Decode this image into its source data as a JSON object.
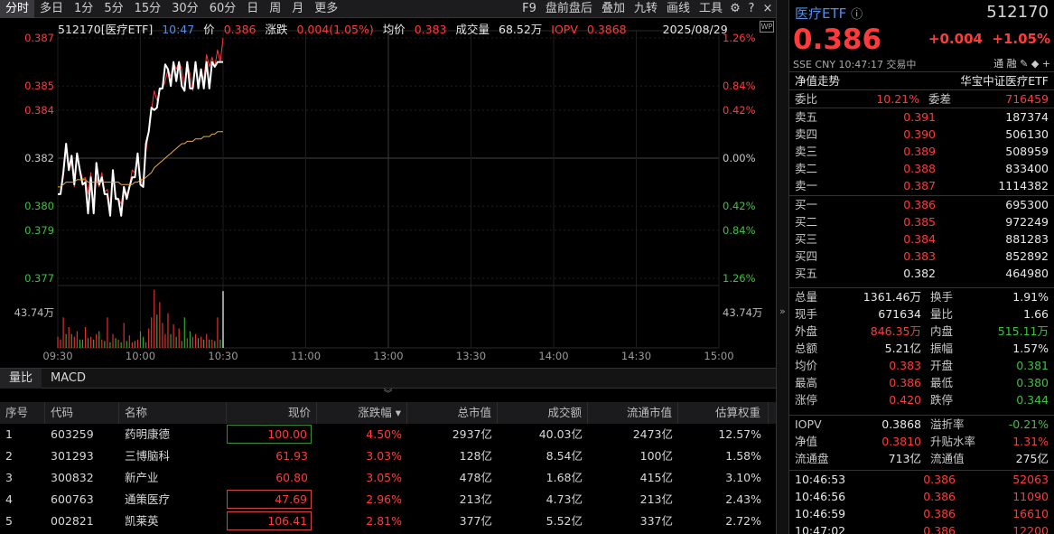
{
  "toolbar": {
    "tabs": [
      "分时",
      "多日",
      "1分",
      "5分",
      "15分",
      "30分",
      "60分",
      "日",
      "周",
      "月",
      "更多"
    ],
    "right_tabs": [
      "F9",
      "盘前盘后",
      "叠加",
      "九转",
      "画线",
      "工具"
    ]
  },
  "info": {
    "code_name": "512170[医疗ETF]",
    "time": "10:47",
    "price_label": "价",
    "price": "0.386",
    "chg_label": "涨跌",
    "chg": "0.004(1.05%)",
    "avg_label": "均价",
    "avg": "0.383",
    "vol_label": "成交量",
    "vol": "68.52万",
    "iopv_label": "IOPV",
    "iopv": "0.3868",
    "date": "2025/08/29",
    "logo": "WP"
  },
  "chart_data": {
    "type": "line",
    "title": "",
    "y_left_ticks": [
      "0.387",
      "0.385",
      "0.384",
      "0.382",
      "0.380",
      "0.379",
      "0.377"
    ],
    "y_right_ticks": [
      "1.26%",
      "0.84%",
      "0.42%",
      "0.00%",
      "0.42%",
      "0.84%",
      "1.26%"
    ],
    "prev_close": 0.382,
    "ylim": [
      0.377,
      0.387
    ],
    "x_ticks": [
      "09:30",
      "10:00",
      "10:30",
      "11:00",
      "13:00",
      "13:30",
      "14:00",
      "14:30",
      "15:00"
    ],
    "vol_label": "43.74万",
    "vol_max": 43.74,
    "series": [
      {
        "values": [
          0.3805,
          0.3805,
          0.3812,
          0.3825,
          0.3815,
          0.3818,
          0.3808,
          0.3822,
          0.3816,
          0.3811,
          0.3812,
          0.3805,
          0.3814,
          0.3798,
          0.3812,
          0.3808,
          0.3814,
          0.3806,
          0.3807,
          0.3799,
          0.3815,
          0.3804,
          0.3803,
          0.3801,
          0.3808,
          0.3805,
          0.3808,
          0.3815,
          0.3814,
          0.3822,
          0.3812,
          0.3808,
          0.3823,
          0.3831,
          0.384,
          0.3848,
          0.3844,
          0.3848,
          0.3849,
          0.3852,
          0.3857,
          0.3854,
          0.386,
          0.3857,
          0.386,
          0.3857,
          0.3849,
          0.386,
          0.3855,
          0.3848,
          0.3858,
          0.3852,
          0.3855,
          0.3853,
          0.3863,
          0.3858,
          0.3862,
          0.3858,
          0.3865,
          0.386,
          0.387
        ]
      },
      {
        "values": [
          0.3805,
          0.3805,
          0.3814,
          0.3826,
          0.3815,
          0.3821,
          0.3809,
          0.3822,
          0.3815,
          0.3809,
          0.381,
          0.3797,
          0.3812,
          0.3797,
          0.3818,
          0.3809,
          0.3812,
          0.3805,
          0.3805,
          0.3796,
          0.3815,
          0.3803,
          0.3803,
          0.3796,
          0.3808,
          0.3803,
          0.3808,
          0.3812,
          0.3812,
          0.3822,
          0.3809,
          0.3808,
          0.3826,
          0.3831,
          0.3841,
          0.384,
          0.3841,
          0.3849,
          0.3849,
          0.3859,
          0.3857,
          0.385,
          0.386,
          0.3852,
          0.386,
          0.385,
          0.3848,
          0.386,
          0.3849,
          0.3849,
          0.386,
          0.3849,
          0.3857,
          0.3849,
          0.386,
          0.3849,
          0.386,
          0.3858,
          0.386,
          0.386,
          0.386
        ]
      },
      {
        "values": [
          0.3808,
          0.3808,
          0.3809,
          0.381,
          0.381,
          0.381,
          0.381,
          0.3811,
          0.3811,
          0.3811,
          0.3811,
          0.381,
          0.381,
          0.381,
          0.381,
          0.381,
          0.381,
          0.381,
          0.381,
          0.381,
          0.381,
          0.381,
          0.381,
          0.3809,
          0.3809,
          0.3809,
          0.3809,
          0.3809,
          0.381,
          0.381,
          0.3811,
          0.3811,
          0.3812,
          0.3813,
          0.3814,
          0.3816,
          0.3817,
          0.3818,
          0.3819,
          0.382,
          0.3821,
          0.3822,
          0.3823,
          0.3824,
          0.3825,
          0.3826,
          0.3826,
          0.3827,
          0.3827,
          0.3827,
          0.3828,
          0.3828,
          0.3828,
          0.3829,
          0.3829,
          0.3829,
          0.383,
          0.383,
          0.3831,
          0.3831,
          0.3831
        ]
      }
    ],
    "volumes": [
      8,
      6,
      22,
      10,
      15,
      10,
      8,
      12,
      6,
      6,
      15,
      7,
      8,
      6,
      10,
      12,
      6,
      5,
      22,
      4,
      10,
      7,
      6,
      4,
      18,
      5,
      9,
      4,
      5,
      6,
      12,
      8,
      4,
      14,
      22,
      42,
      24,
      33,
      18,
      10,
      25,
      10,
      17,
      8,
      14,
      5,
      22,
      7,
      12,
      8,
      10,
      7,
      8,
      6,
      10,
      6,
      6,
      5,
      22,
      6,
      41
    ],
    "vol_up": [
      1,
      1,
      1,
      0,
      1,
      0,
      1,
      1,
      0,
      0,
      1,
      0,
      1,
      0,
      1,
      0,
      1,
      0,
      1,
      0,
      1,
      0,
      1,
      0,
      1,
      0,
      1,
      1,
      0,
      1,
      0,
      0,
      1,
      1,
      1,
      1,
      0,
      1,
      1,
      1,
      1,
      0,
      1,
      0,
      1,
      0,
      0,
      1,
      0,
      1,
      1,
      0,
      1,
      0,
      1,
      0,
      1,
      0,
      1,
      0,
      2
    ]
  },
  "subtabs": [
    "量比",
    "MACD"
  ],
  "table": {
    "headers": [
      "序号",
      "代码",
      "名称",
      "现价",
      "涨跌幅",
      "总市值",
      "成交额",
      "流通市值",
      "估算权重"
    ],
    "rows": [
      [
        "1",
        "603259",
        "药明康德",
        "100.00",
        "4.50%",
        "2937亿",
        "40.03亿",
        "2473亿",
        "12.57%"
      ],
      [
        "2",
        "301293",
        "三博脑科",
        "61.93",
        "3.03%",
        "128亿",
        "8.54亿",
        "100亿",
        "1.58%"
      ],
      [
        "3",
        "300832",
        "新产业",
        "60.80",
        "3.05%",
        "478亿",
        "1.68亿",
        "415亿",
        "3.10%"
      ],
      [
        "4",
        "600763",
        "通策医疗",
        "47.69",
        "2.96%",
        "213亿",
        "4.73亿",
        "213亿",
        "2.43%"
      ],
      [
        "5",
        "002821",
        "凯莱英",
        "106.41",
        "2.81%",
        "377亿",
        "5.52亿",
        "337亿",
        "2.72%"
      ]
    ]
  },
  "panel": {
    "title": "医疗ETF",
    "code": "512170",
    "price": "0.386",
    "chg": "+0.004",
    "pct": "+1.05%",
    "meta": "SSE  CNY  10:47:17  交易中",
    "icons": "通 融 ✎ ◆ +",
    "nav_label": "净值走势",
    "index_name": "华宝中证医疗ETF",
    "webi_label": "委比",
    "webi": "10.21%",
    "weicha_label": "委差",
    "weicha": "716459",
    "asks": [
      [
        "卖五",
        "0.391",
        "187374"
      ],
      [
        "卖四",
        "0.390",
        "506130"
      ],
      [
        "卖三",
        "0.389",
        "508959"
      ],
      [
        "卖二",
        "0.388",
        "833400"
      ],
      [
        "卖一",
        "0.387",
        "1114382"
      ]
    ],
    "bids": [
      [
        "买一",
        "0.386",
        "695300"
      ],
      [
        "买二",
        "0.385",
        "972249"
      ],
      [
        "买三",
        "0.384",
        "881283"
      ],
      [
        "买四",
        "0.383",
        "852892"
      ],
      [
        "买五",
        "0.382",
        "464980"
      ]
    ],
    "stats": [
      [
        "总量",
        "1361.46万",
        "换手",
        "1.91%"
      ],
      [
        "现手",
        "671634",
        "量比",
        "1.66"
      ],
      [
        "外盘",
        "846.35万",
        "内盘",
        "515.11万"
      ],
      [
        "总额",
        "5.21亿",
        "振幅",
        "1.57%"
      ],
      [
        "均价",
        "0.383",
        "开盘",
        "0.381"
      ],
      [
        "最高",
        "0.386",
        "最低",
        "0.380"
      ],
      [
        "涨停",
        "0.420",
        "跌停",
        "0.344"
      ]
    ],
    "stats2": [
      [
        "IOPV",
        "0.3868",
        "溢折率",
        "-0.21%"
      ],
      [
        "净值",
        "0.3810",
        "升贴水率",
        "1.31%"
      ],
      [
        "流通盘",
        "713亿",
        "流通值",
        "275亿"
      ]
    ],
    "ticks": [
      [
        "10:46:53",
        "0.386",
        "52063"
      ],
      [
        "10:46:56",
        "0.386",
        "11090"
      ],
      [
        "10:46:59",
        "0.386",
        "16610"
      ],
      [
        "10:47:02",
        "0.386",
        "12200"
      ]
    ]
  }
}
